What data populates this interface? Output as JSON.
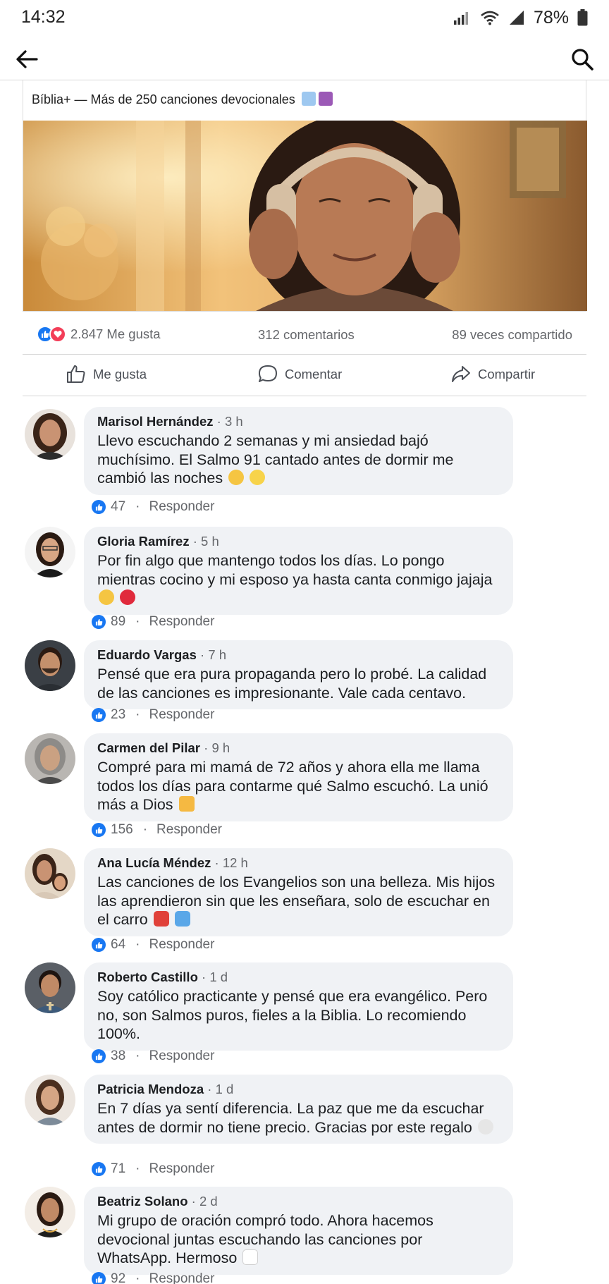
{
  "status": {
    "time": "14:32",
    "battery": "78%"
  },
  "post": {
    "caption": "Bíblia+ — Más de 250 canciones devocionales",
    "likes": "2.847 Me gusta",
    "comments": "312 comentarios",
    "shares": "89 veces compartido"
  },
  "actions": {
    "like": "Me gusta",
    "comment": "Comentar",
    "share": "Compartir"
  },
  "reply_label": "Responder",
  "comments": [
    {
      "name": "Marisol Hernández",
      "time": "3 h",
      "text": "Llevo escuchando 2 semanas y mi ansiedad bajó muchísimo. El Salmo 91 cantado antes de dormir me cambió las noches",
      "likes": "47"
    },
    {
      "name": "Gloria Ramírez",
      "time": "5 h",
      "text": "Por fin algo que mantengo todos los días. Lo pongo mientras cocino y mi esposo ya hasta canta conmigo jajaja",
      "likes": "89"
    },
    {
      "name": "Eduardo Vargas",
      "time": "7 h",
      "text": "Pensé que era pura propaganda pero lo probé. La calidad de las canciones es impresionante. Vale cada centavo.",
      "likes": "23"
    },
    {
      "name": "Carmen del Pilar",
      "time": "9 h",
      "text": "Compré para mi mamá de 72 años y ahora ella me llama todos los días para contarme qué Salmo escuchó. La unió más a Dios",
      "likes": "156"
    },
    {
      "name": "Ana Lucía Méndez",
      "time": "12 h",
      "text": "Las canciones de los Evangelios son una belleza. Mis hijos las aprendieron sin que les enseñara, solo de escuchar en el carro",
      "likes": "64"
    },
    {
      "name": "Roberto Castillo",
      "time": "1 d",
      "text": "Soy católico practicante y pensé que era evangélico. Pero no, son Salmos puros, fieles a la Biblia. Lo recomiendo 100%.",
      "likes": "38"
    },
    {
      "name": "Patricia Mendoza",
      "time": "1 d",
      "text": "En 7 días ya sentí diferencia. La paz que me da escuchar antes de dormir no tiene precio. Gracias por este regalo",
      "likes": "71"
    },
    {
      "name": "Beatriz Solano",
      "time": "2 d",
      "text": "Mi grupo de oración compró todo. Ahora hacemos devocional juntas escuchando las canciones por WhatsApp. Hermoso",
      "likes": "92"
    }
  ],
  "colors": {
    "brand_blue": "#1877f2",
    "heart_red": "#f33e58",
    "bubble_bg": "#f0f2f5",
    "meta_gray": "#65676b"
  }
}
